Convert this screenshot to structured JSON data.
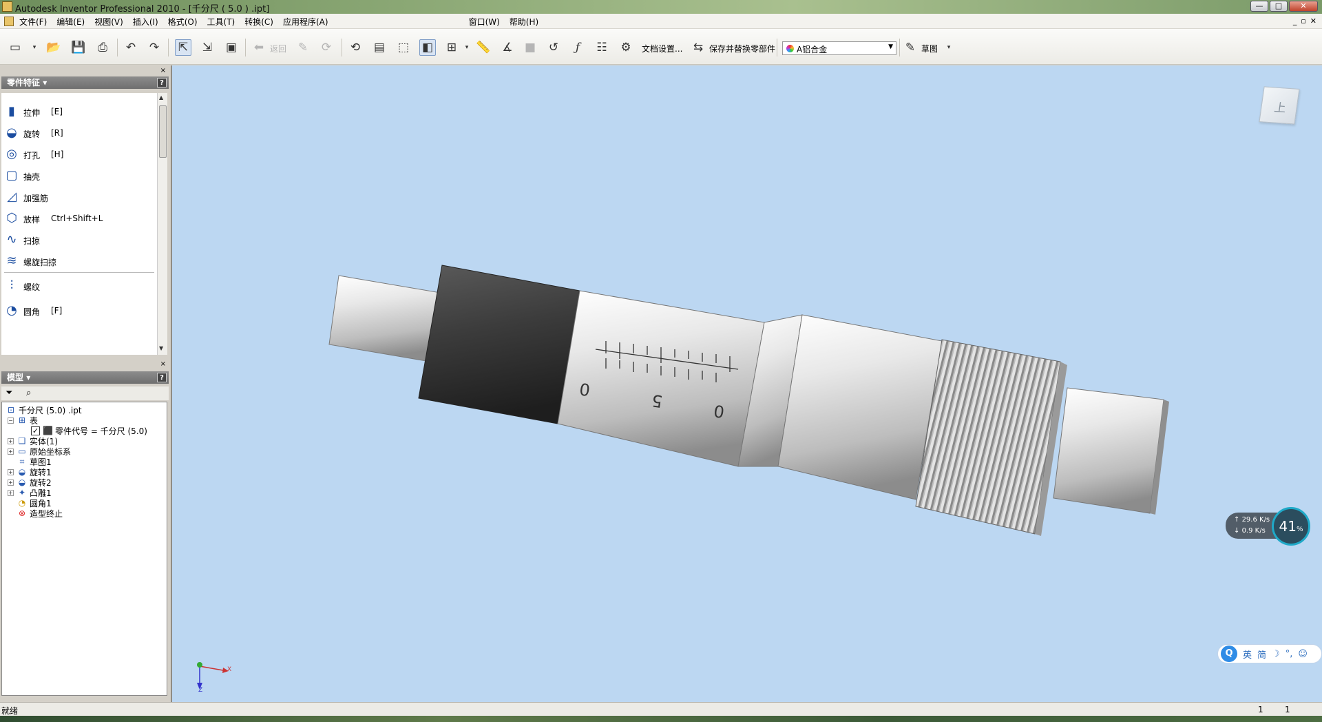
{
  "window": {
    "title": "Autodesk Inventor Professional 2010 - [千分尺 ( 5.0 ) .ipt]",
    "min": "—",
    "max": "□",
    "close": "✕"
  },
  "menubar": {
    "items": [
      "文件(F)",
      "编辑(E)",
      "视图(V)",
      "插入(I)",
      "格式(O)",
      "工具(T)",
      "转换(C)",
      "应用程序(A)",
      "窗口(W)",
      "帮助(H)"
    ],
    "mdi_min": "_",
    "mdi_restore": "▫",
    "mdi_close": "✕"
  },
  "toolbar": {
    "back_label": "返回",
    "doc_settings": "文档设置...",
    "save_replace": "保存并替换零部件",
    "material_value": "A铝合金",
    "sketch_label": "草图"
  },
  "features_panel": {
    "title": "零件特征",
    "help": "?",
    "close": "×",
    "items": [
      {
        "label": "拉伸",
        "key": "[E]",
        "icon": "extrude-icon"
      },
      {
        "label": "旋转",
        "key": "[R]",
        "icon": "revolve-icon"
      },
      {
        "label": "打孔",
        "key": "[H]",
        "icon": "hole-icon"
      },
      {
        "label": "抽壳",
        "key": "",
        "icon": "shell-icon"
      },
      {
        "label": "加强筋",
        "key": "",
        "icon": "rib-icon"
      },
      {
        "label": "放样",
        "key": "Ctrl+Shift+L",
        "icon": "loft-icon"
      },
      {
        "label": "扫掠",
        "key": "",
        "icon": "sweep-icon"
      },
      {
        "label": "螺旋扫掠",
        "key": "",
        "icon": "coil-icon"
      },
      {
        "label": "螺纹",
        "key": "",
        "icon": "thread-icon"
      },
      {
        "label": "圆角",
        "key": "[F]",
        "icon": "fillet-icon"
      }
    ]
  },
  "model_panel": {
    "title": "模型",
    "help": "?",
    "close": "×",
    "tree": [
      {
        "label": "千分尺 (5.0) .ipt",
        "icon": "part-icon"
      },
      {
        "label": "表",
        "icon": "table-icon"
      },
      {
        "label": "零件代号 = 千分尺 (5.0)",
        "icon": "parameter-icon"
      },
      {
        "label": "实体(1)",
        "icon": "solid-bodies-icon"
      },
      {
        "label": "原始坐标系",
        "icon": "origin-folder-icon"
      },
      {
        "label": "草图1",
        "icon": "sketch-icon"
      },
      {
        "label": "旋转1",
        "icon": "revolve-icon"
      },
      {
        "label": "旋转2",
        "icon": "revolve-icon"
      },
      {
        "label": "凸雕1",
        "icon": "emboss-icon"
      },
      {
        "label": "圆角1",
        "icon": "fillet-icon"
      },
      {
        "label": "造型终止",
        "icon": "end-of-part-icon"
      }
    ]
  },
  "viewport": {
    "viewcube_face": "上",
    "scale_marks": [
      "0",
      "5",
      "0"
    ],
    "axis_x": "X",
    "axis_z": "Z"
  },
  "net_widget": {
    "upload": "29.6 K/s",
    "download": "0.9 K/s",
    "percent": "41",
    "percent_sign": "%"
  },
  "ime": {
    "q": "Q",
    "lang": "英",
    "mode": "简",
    "moon": "☽",
    "punct": "°,",
    "smile": "☺"
  },
  "status": {
    "text": "就绪",
    "count1": "1",
    "count2": "1"
  }
}
